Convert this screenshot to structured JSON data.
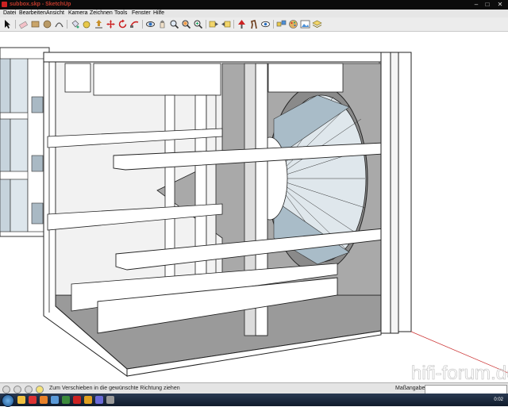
{
  "window": {
    "title": "subbox.skp - SketchUp"
  },
  "menu": {
    "items": [
      "Datei",
      "Bearbeiten",
      "Ansicht",
      "Kamera",
      "Zeichnen",
      "Tools",
      "Fenster",
      "Hilfe"
    ]
  },
  "toolbar": {
    "tools": [
      "select-arrow",
      "eraser",
      "rectangle",
      "circle",
      "arc",
      "paint-bucket",
      "tape-measure",
      "push-pull",
      "move",
      "rotate",
      "follow-me",
      "orbit",
      "pan",
      "zoom",
      "zoom-extents",
      "zoom-window",
      "previous-view",
      "position-camera",
      "walk",
      "look-around",
      "components",
      "materials",
      "scenes",
      "layers"
    ]
  },
  "statusbar": {
    "hint": "Zum Verschieben in die gewünschte Richtung ziehen",
    "measurement_label": "Maßangaben",
    "measurement_value": ""
  },
  "taskbar": {
    "clock": "0:02"
  },
  "watermark": "hifi-forum.de",
  "colors": {
    "title_red": "#c0392b",
    "model_face": "#ffffff",
    "model_shadow": "#9a9a9a",
    "speaker_cone": "#c5d3dc"
  }
}
